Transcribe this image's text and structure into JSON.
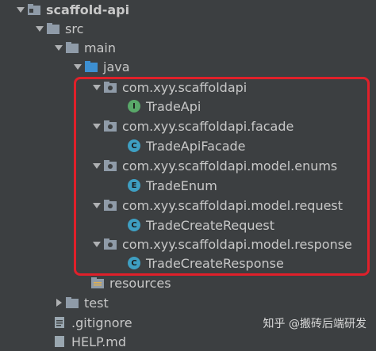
{
  "tree": {
    "root": "scaffold-api",
    "src": "src",
    "main": "main",
    "java": "java",
    "pkg1": "com.xyy.scaffoldapi",
    "cls1": "TradeApi",
    "pkg2": "com.xyy.scaffoldapi.facade",
    "cls2": "TradeApiFacade",
    "pkg3": "com.xyy.scaffoldapi.model.enums",
    "cls3": "TradeEnum",
    "pkg4": "com.xyy.scaffoldapi.model.request",
    "cls4": "TradeCreateRequest",
    "pkg5": "com.xyy.scaffoldapi.model.response",
    "cls5": "TradeCreateResponse",
    "resources": "resources",
    "test": "test",
    "gitignore": ".gitignore",
    "help": "HELP.md"
  },
  "badges": {
    "interface": "I",
    "class": "C",
    "enum": "E"
  },
  "watermark": {
    "text": "知乎 @搬砖后端研发"
  },
  "colors": {
    "background": "#3c3f41",
    "highlight": "#e0202a",
    "interface_badge": "#59a869",
    "class_badge": "#3e9fc2",
    "enum_badge": "#3e9fc2",
    "folder": "#8f9ba8",
    "java_folder": "#3d8fd1"
  }
}
